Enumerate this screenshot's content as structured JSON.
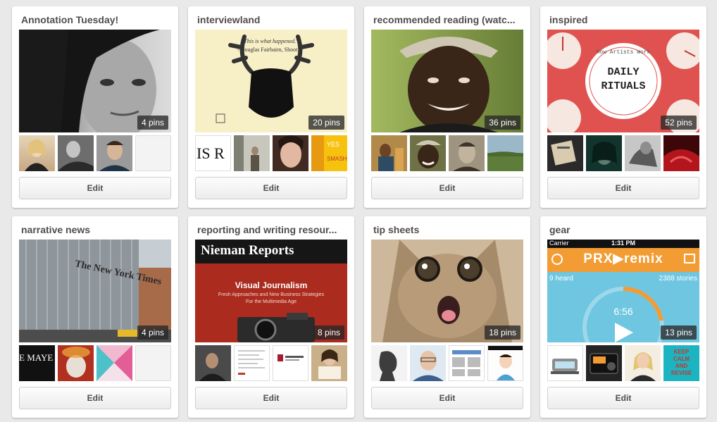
{
  "boards": [
    {
      "title": "Annotation Tuesday!",
      "pins": "4 pins",
      "edit": "Edit"
    },
    {
      "title": "interviewland",
      "pins": "20 pins",
      "edit": "Edit",
      "cover_quote": "\"This is what happened.\"",
      "cover_author": "- Douglas Fairbairn, Shoot"
    },
    {
      "title": "recommended reading (watc...",
      "pins": "36 pins",
      "edit": "Edit"
    },
    {
      "title": "inspired",
      "pins": "52 pins",
      "edit": "Edit",
      "cover_line1": "DAILY",
      "cover_line2": "RITUALS",
      "cover_ring": "How Artists Work"
    },
    {
      "title": "narrative news",
      "pins": "4 pins",
      "edit": "Edit",
      "cover_building_text": "The New York Times",
      "thumb_text": "E MAYE"
    },
    {
      "title": "reporting and writing resour...",
      "pins": "8 pins",
      "edit": "Edit",
      "cover_brand": "Nieman Reports",
      "cover_heading": "Visual Journalism",
      "cover_sub1": "Fresh Approaches and New Business Strategies",
      "cover_sub2": "For the Multimedia Age"
    },
    {
      "title": "tip sheets",
      "pins": "18 pins",
      "edit": "Edit"
    },
    {
      "title": "gear",
      "pins": "13 pins",
      "edit": "Edit",
      "cover_carrier": "Carrier",
      "cover_time": "1:31 PM",
      "cover_app": "PRX▶remix",
      "cover_heard": "9 heard",
      "cover_stories": "2388 stories",
      "cover_timer": "6:56",
      "thumb_text": "KEEP CALM AND REVISE"
    }
  ],
  "thumb_labels": {
    "interview_thumb1": "IS R"
  },
  "colors": {
    "page_bg": "#e9e9e9",
    "card_bg": "#ffffff",
    "title": "#524d4d",
    "daily_red": "#e0524f",
    "prx_orange": "#f39c33",
    "prx_blue": "#6ec6e1"
  }
}
